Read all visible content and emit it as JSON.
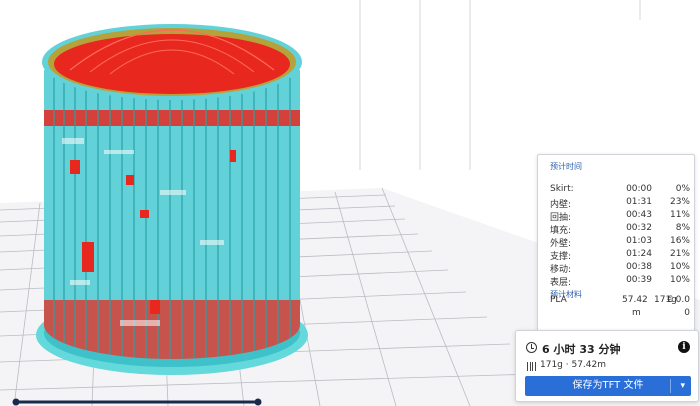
{
  "estimate": {
    "time_title": "预计时间",
    "rows": [
      {
        "label": "Skirt:",
        "time": "00:00",
        "percent": "0%"
      },
      {
        "label": "内壁:",
        "time": "01:31",
        "percent": "23%"
      },
      {
        "label": "回抽:",
        "time": "00:43",
        "percent": "11%"
      },
      {
        "label": "填充:",
        "time": "00:32",
        "percent": "8%"
      },
      {
        "label": "外壁:",
        "time": "01:03",
        "percent": "16%"
      },
      {
        "label": "支撑:",
        "time": "01:24",
        "percent": "21%"
      },
      {
        "label": "移动:",
        "time": "00:38",
        "percent": "10%"
      },
      {
        "label": "表层:",
        "time": "00:39",
        "percent": "10%"
      }
    ],
    "material_title": "预计材料",
    "material_rows": [
      {
        "name": "PLA",
        "length": "57.42",
        "weight": "171g",
        "cost": "€ 0.0"
      },
      {
        "name": "",
        "length": "m",
        "weight": "",
        "cost": "0"
      }
    ]
  },
  "summary": {
    "print_time": "6 小时 33 分钟",
    "material": "171g · 57.42m",
    "save_label": "保存为TFT 文件",
    "clock_icon": "clock-icon",
    "info_icon": "info-icon",
    "spool_icon": "spool-icon",
    "dropdown_icon": "chevron-down-icon"
  },
  "colors": {
    "accent": "#2a6ed8",
    "model_wall": "#5fd4d8",
    "model_inner": "#e8281e",
    "model_seam": "#7bd86a"
  }
}
